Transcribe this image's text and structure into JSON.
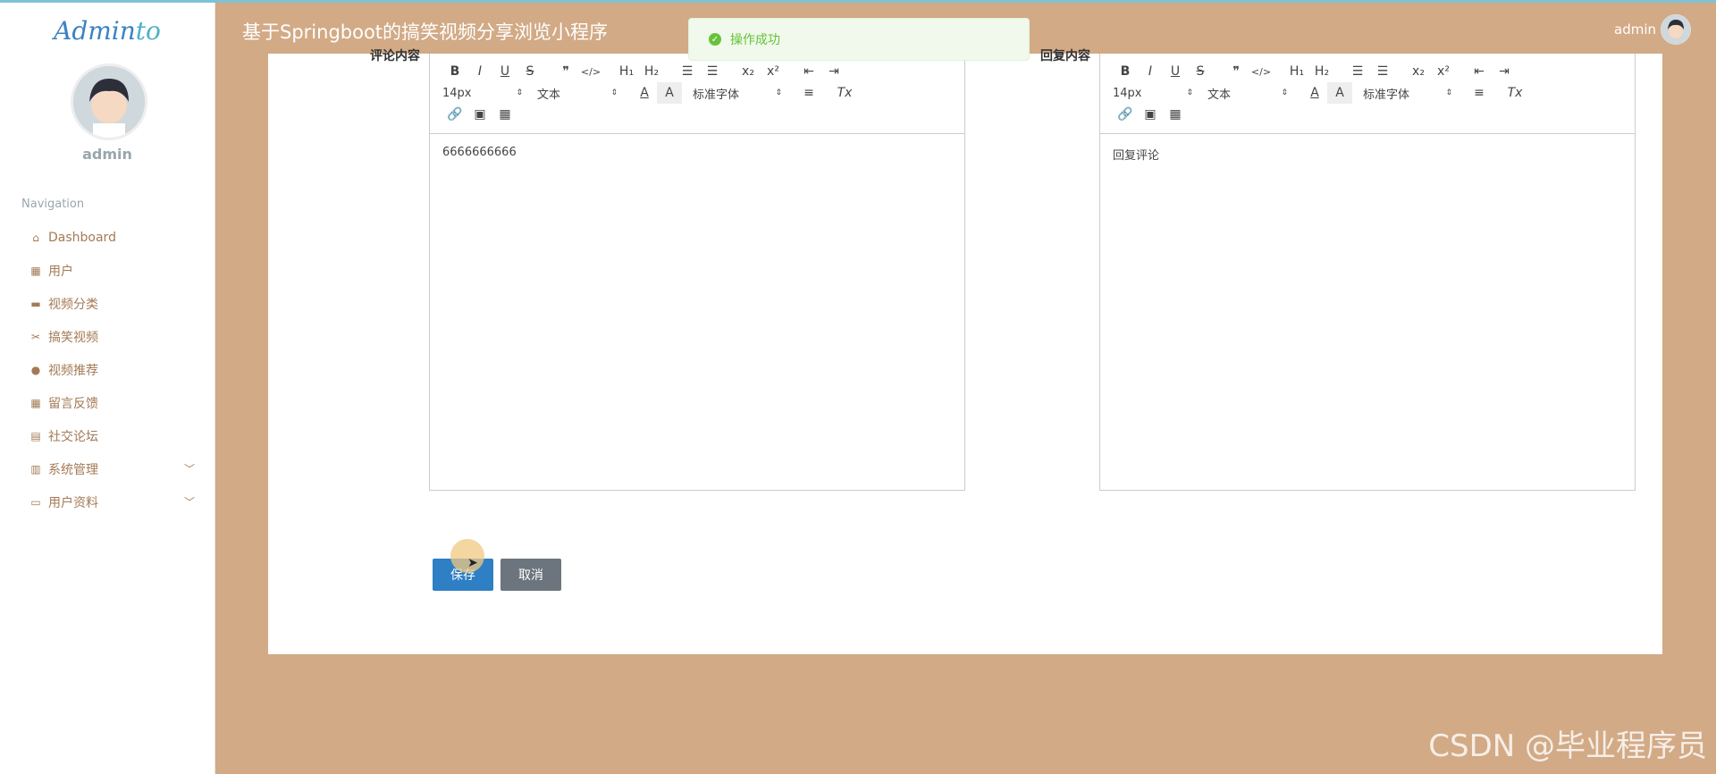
{
  "app": {
    "logo_main": "Admin",
    "logo_accent": "to",
    "title": "基于Springboot的搞笑视频分享浏览小程序",
    "user": "admin"
  },
  "sidebar": {
    "username": "admin",
    "nav_title": "Navigation",
    "items": [
      {
        "label": "Dashboard",
        "icon": "home-icon"
      },
      {
        "label": "用户",
        "icon": "grid-icon"
      },
      {
        "label": "视频分类",
        "icon": "tray-icon"
      },
      {
        "label": "搞笑视频",
        "icon": "ticket-icon"
      },
      {
        "label": "视频推荐",
        "icon": "person-icon"
      },
      {
        "label": "留言反馈",
        "icon": "grid-icon"
      },
      {
        "label": "社交论坛",
        "icon": "clipboard-icon"
      },
      {
        "label": "系统管理",
        "icon": "bar-chart-icon"
      },
      {
        "label": "用户资料",
        "icon": "card-icon"
      }
    ]
  },
  "toast": {
    "message": "操作成功"
  },
  "form": {
    "left_label": "评论内容",
    "right_label": "回复内容",
    "left_content": "6666666666",
    "right_content": "回复评论",
    "save_label": "保存",
    "cancel_label": "取消"
  },
  "toolbar": {
    "font_size": "14px",
    "header": "文本",
    "font_family": "标准字体",
    "bold": "B",
    "italic": "I",
    "underline": "U",
    "strike": "S",
    "quote": "❞",
    "code": "</>",
    "h1": "H₁",
    "h2": "H₂",
    "ol": "☰",
    "ul": "☰",
    "sub": "x₂",
    "sup": "x²",
    "outdent": "⇤",
    "indent": "⇥",
    "color": "A",
    "background": "A",
    "align": "≡",
    "clean": "Tx",
    "link": "🔗",
    "image": "▣",
    "video": "▦"
  },
  "watermark": "CSDN @毕业程序员",
  "colors": {
    "background": "#d2aa86",
    "menu_text": "#a37a55",
    "save_button": "#2e7fc4",
    "cancel_button": "#6c757d",
    "toast_bg": "#f0f9eb",
    "toast_text": "#67c23a"
  }
}
